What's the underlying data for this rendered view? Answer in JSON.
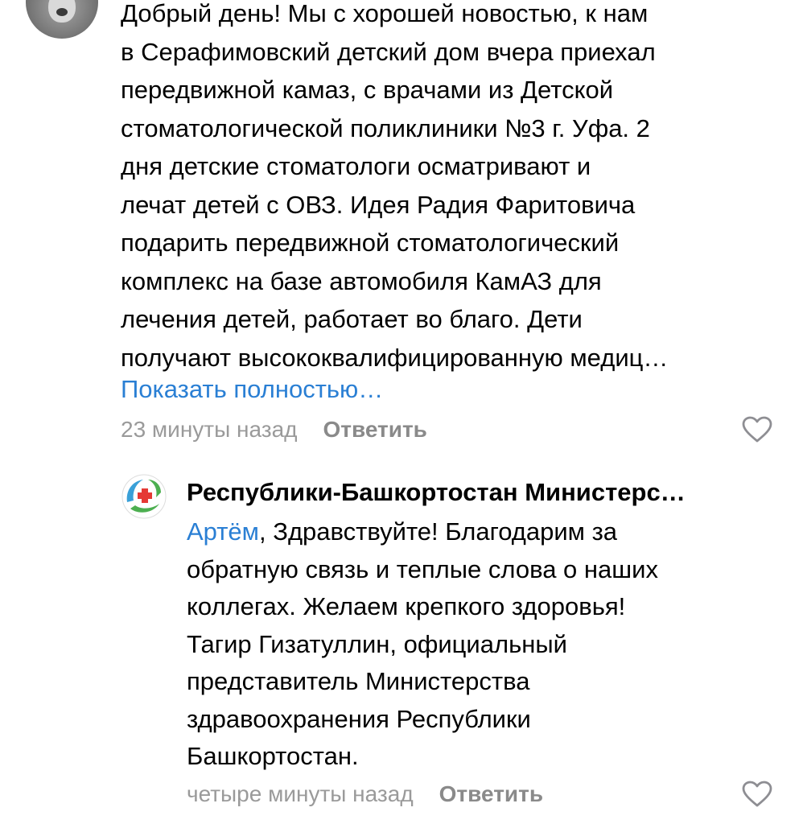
{
  "comment": {
    "text_lines": "Добрый день! Мы с хорошей новостью, к нам\nв Серафимовский детский дом вчера приехал\nпередвижной камаз, с врачами из Детской\nстоматологической поликлиники №3 г. Уфа. 2\nдня детские стоматологи осматривают и\nлечат детей с ОВЗ. Идея Радия Фаритовича\nподарить передвижной стоматологический\nкомплекс на базе автомобиля КамАЗ для\nлечения детей, работает во благо. Дети\nполучают высококвалифицированную медиц…",
    "show_full_label": "Показать полностью…",
    "time": "23 минуты назад",
    "reply_label": "Ответить",
    "like_icon": "heart-outline-icon"
  },
  "reply": {
    "author": "Республики-Башкортостан Министерс…",
    "mention": "Артём",
    "text_lines": ", Здравствуйте! Благодарим за\nобратную связь и теплые слова о наших\nколлегах. Желаем крепкого здоровья!\nТагир Гизатуллин, официальный\nпредставитель Министерства\nздравоохранения Республики\nБашкортостан.",
    "time": "четыре минуты назад",
    "reply_label": "Ответить",
    "like_icon": "heart-outline-icon"
  },
  "colors": {
    "link": "#2a7fd4",
    "muted": "#9a9a9a",
    "reply_button": "#8a8a8a",
    "logo_green": "#4caf50",
    "logo_red": "#e53935"
  }
}
